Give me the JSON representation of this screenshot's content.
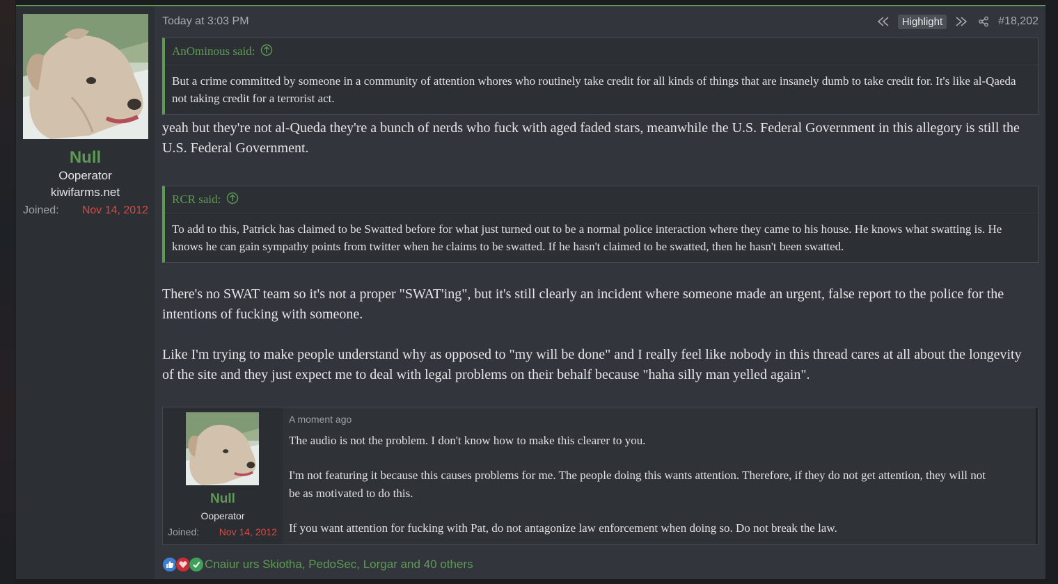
{
  "colors": {
    "accent": "#5e9a54",
    "joined_date": "#d94a43",
    "background": "#32353b"
  },
  "post": {
    "date": "Today at 3:03 PM",
    "tools": {
      "highlight_label": "Highlight",
      "post_number": "#18,202",
      "icons": [
        "prev-highlight-icon",
        "next-highlight-icon",
        "share-icon"
      ]
    },
    "author": {
      "name": "Null",
      "title": "Ooperator",
      "domain": "kiwifarms.net",
      "joined_label": "Joined:",
      "joined_date": "Nov 14, 2012"
    },
    "quotes": [
      {
        "author": "AnOminous said:",
        "text": "But a crime committed by someone in a community of attention whores who routinely take credit for all kinds of things that are insanely dumb to take credit for. It's like al-Qaeda not taking credit for a terrorist act."
      },
      {
        "author": "RCR said:",
        "text": "To add to this, Patrick has claimed to be Swatted before for what just turned out to be a normal police interaction where they came to his house. He knows what swatting is. He knows he can gain sympathy points from twitter when he claims to be swatted. If he hasn't claimed to be swatted, then he hasn't been swatted."
      }
    ],
    "replies": [
      "yeah but they're not al-Queda they're a bunch of nerds who fuck with aged faded stars, meanwhile the U.S. Federal Government in this allegory is still the U.S. Federal Government.",
      "There's no SWAT team so it's not a proper \"SWAT'ing\", but it's still clearly an incident where someone made an urgent, false report to the police for the intentions of fucking with someone.",
      "Like I'm trying to make people understand why as opposed to \"my will be done\" and I really feel like nobody in this thread cares at all about the longevity of the site and they just expect me to deal with legal problems on their behalf because \"haha silly man yelled again\"."
    ],
    "embed": {
      "date": "A moment ago",
      "author_name": "Null",
      "author_title": "Ooperator",
      "joined_label": "Joined:",
      "joined_date": "Nov 14, 2012",
      "paragraphs": [
        "The audio is not the problem. I don't know how to make this clearer to you.",
        "I'm not featuring it because this causes problems for me. The people doing this wants attention. Therefore, if they do not get attention, they will not be as motivated to do this.",
        "If you want attention for fucking with Pat, do not antagonize law enforcement when doing so. Do not break the law."
      ]
    },
    "reactions": {
      "icons": [
        "like-icon",
        "heart-icon",
        "check-icon"
      ],
      "text": "Cnaiur urs Skiotha, PedoSec, Lorgar and 40 others"
    }
  }
}
